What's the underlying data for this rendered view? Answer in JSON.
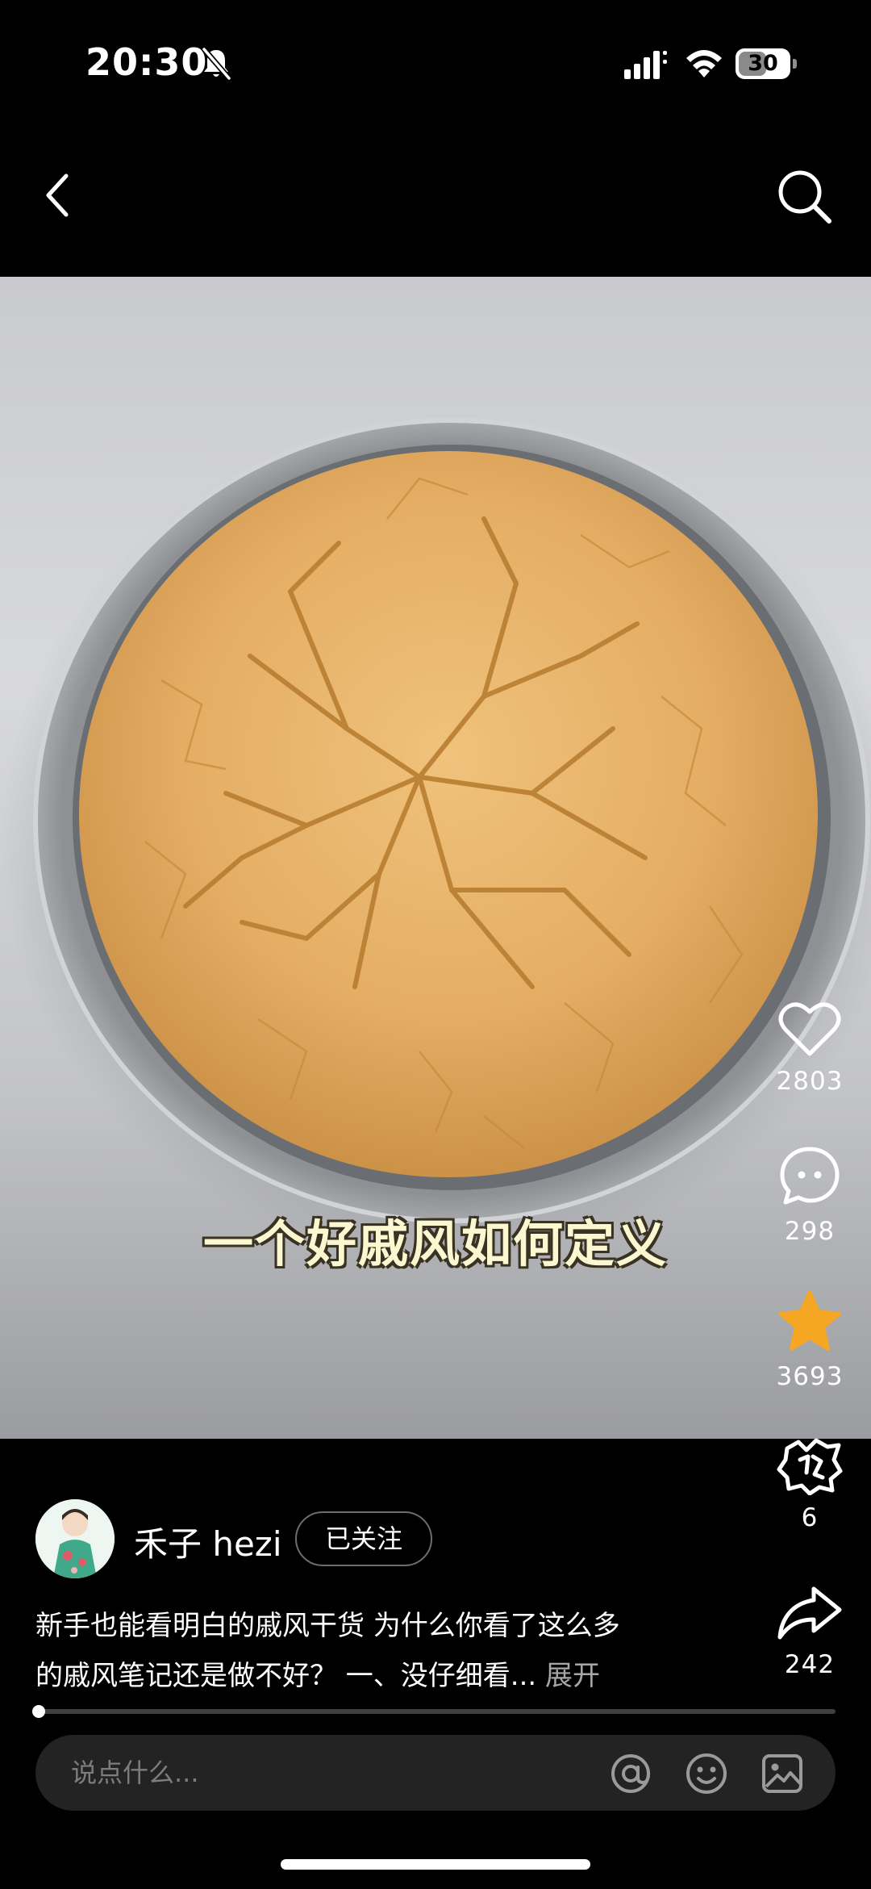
{
  "status_bar": {
    "time": "20:30",
    "battery_level": "30",
    "icons": [
      "bell-slash-icon",
      "signal-icon",
      "wifi-icon",
      "battery-icon"
    ]
  },
  "nav": {
    "back_icon": "chevron-left-icon",
    "search_icon": "search-icon"
  },
  "video": {
    "subtitle": "一个好戚风如何定义",
    "progress": 0.01
  },
  "actions": {
    "like_count": "2803",
    "comment_count": "298",
    "favorite_count": "3693",
    "reward_count": "6",
    "share_count": "242",
    "favorite_color": "#f5a623"
  },
  "author": {
    "name": "禾子 hezi",
    "follow_label": "已关注"
  },
  "description": {
    "line1": "新手也能看明白的戚风干货 为什么你看了这么多",
    "line2": "的戚风笔记还是做不好？ 一、没仔细看...",
    "expand_label": "展开"
  },
  "comment_bar": {
    "placeholder": "说点什么...",
    "icons": [
      "at-icon",
      "emoji-icon",
      "image-icon"
    ]
  }
}
